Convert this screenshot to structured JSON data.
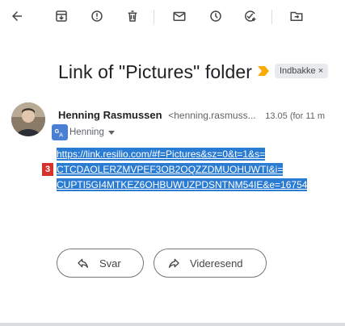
{
  "toolbar": {
    "icons": [
      "back-arrow-icon",
      "archive-icon",
      "report-spam-icon",
      "delete-icon",
      "mark-unread-icon",
      "snooze-icon",
      "add-task-icon",
      "move-to-icon"
    ]
  },
  "email": {
    "subject": "Link of \"Pictures\" folder",
    "label": "Indbakke ×",
    "sender_name": "Henning Rasmussen",
    "sender_email": "<henning.rasmuss...",
    "date": "13.05 (for 11 m",
    "to": "Henning",
    "link_lines": [
      "https://link.resilio.com/#f=Pictures&sz=0&t=1&s=",
      "CTCDAOLERZMVPEF3OB2OQZZDMUOHUWTI&i=",
      "CUPTI5GI4MTKEZ6OHBUWUZPDSNTNM54IE&e=16754"
    ]
  },
  "annotation": {
    "step": "3"
  },
  "actions": {
    "reply_label": "Svar",
    "forward_label": "Videresend"
  },
  "colors": {
    "link_highlight": "#2a7bd2",
    "step_badge": "#d6312b",
    "importance": "#f9ab00"
  }
}
